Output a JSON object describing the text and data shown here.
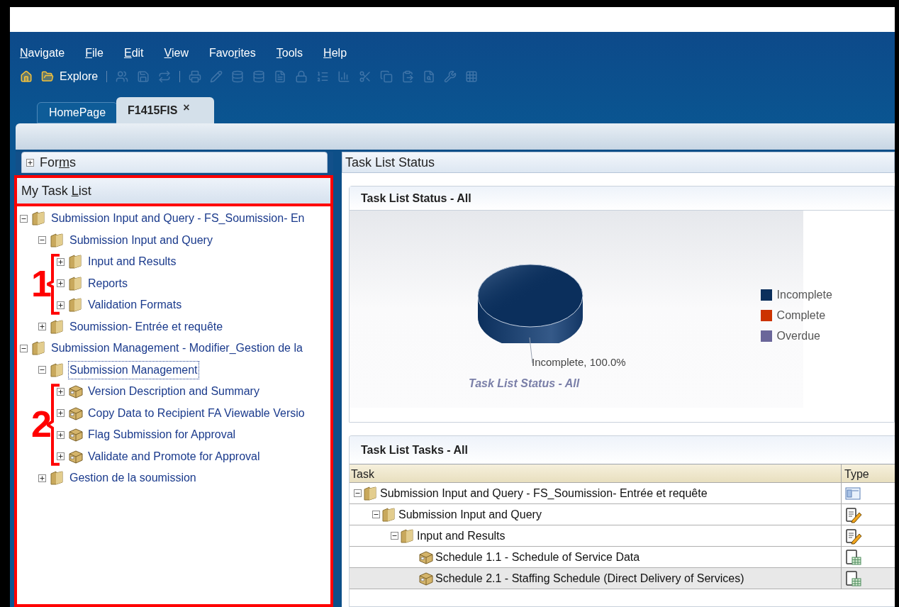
{
  "menu": [
    {
      "key": "N",
      "after": "avigate"
    },
    {
      "key": "F",
      "after": "ile"
    },
    {
      "key": "E",
      "after": "dit"
    },
    {
      "key": "V",
      "after": "iew"
    },
    {
      "before": "Favo",
      "key": "r",
      "after": "ites"
    },
    {
      "key": "T",
      "after": "ools"
    },
    {
      "key": "H",
      "after": "elp"
    }
  ],
  "toolbar": [
    {
      "kind": "icon",
      "disabled": false
    },
    {
      "kind": "icon",
      "disabled": false
    },
    {
      "kind": "button",
      "label": "Explore",
      "disabled": false
    },
    {
      "kind": "separator"
    },
    {
      "kind": "icon",
      "disabled": true
    },
    {
      "kind": "icon",
      "disabled": true
    },
    {
      "kind": "icon",
      "disabled": true
    },
    {
      "kind": "separator"
    },
    {
      "kind": "icon",
      "disabled": true
    },
    {
      "kind": "icon",
      "disabled": true
    },
    {
      "kind": "icon",
      "disabled": true
    },
    {
      "kind": "icon",
      "disabled": true
    },
    {
      "kind": "icon",
      "disabled": true
    },
    {
      "kind": "icon",
      "disabled": true
    },
    {
      "kind": "icon",
      "disabled": true
    },
    {
      "kind": "icon",
      "disabled": true
    },
    {
      "kind": "icon",
      "disabled": true
    },
    {
      "kind": "icon",
      "disabled": true
    },
    {
      "kind": "icon",
      "disabled": true
    },
    {
      "kind": "icon",
      "disabled": true
    },
    {
      "kind": "icon",
      "disabled": true
    },
    {
      "kind": "icon",
      "disabled": true
    }
  ],
  "tabs": [
    {
      "label": "HomePage",
      "selected": false
    },
    {
      "label": "F1415FIS",
      "selected": true,
      "close": "×"
    }
  ],
  "forms_panel": {
    "before": "For",
    "key": "m",
    "after": "s",
    "expanded": false
  },
  "task_list_panel": {
    "title": {
      "before": "My Task ",
      "key": "L",
      "after": "ist"
    },
    "tree": [
      {
        "label": "Submission Input and Query - FS_Soumission- En",
        "kind": "folder",
        "expanded": true,
        "selected": false,
        "children": [
          {
            "label": "Submission Input and Query",
            "kind": "folder",
            "expanded": true,
            "selected": false,
            "children_marker": "1",
            "children": [
              {
                "label": "Input and Results",
                "kind": "folder",
                "expanded": false,
                "selected": false
              },
              {
                "label": "Reports",
                "kind": "folder",
                "expanded": false,
                "selected": false
              },
              {
                "label": "Validation Formats",
                "kind": "folder",
                "expanded": false,
                "selected": false
              }
            ]
          },
          {
            "label": "Soumission- Entrée et requête",
            "kind": "folder",
            "expanded": false,
            "selected": false
          }
        ]
      },
      {
        "label": "Submission Management - Modifier_Gestion de la",
        "kind": "folder",
        "expanded": true,
        "selected": false,
        "children": [
          {
            "label": "Submission Management",
            "kind": "folder",
            "expanded": true,
            "selected": true,
            "children_marker": "2",
            "children": [
              {
                "label": "Version Description and Summary",
                "kind": "task",
                "expanded": false,
                "selected": false
              },
              {
                "label": "Copy Data to Recipient FA Viewable Versio",
                "kind": "task",
                "expanded": false,
                "selected": false
              },
              {
                "label": "Flag Submission for Approval",
                "kind": "task",
                "expanded": false,
                "selected": false
              },
              {
                "label": "Validate and Promote for Approval",
                "kind": "task",
                "expanded": false,
                "selected": false
              }
            ]
          },
          {
            "label": "Gestion de la soumission",
            "kind": "folder",
            "expanded": false,
            "selected": false
          }
        ]
      }
    ]
  },
  "status_panel": {
    "title": "Task List Status",
    "status_card": {
      "title": "Task List Status - All",
      "chart_data": {
        "type": "pie",
        "title": "Task List Status - All",
        "categories": [
          "Incomplete",
          "Complete",
          "Overdue"
        ],
        "colors": [
          "#0b2f5c",
          "#cc3300",
          "#6a669a"
        ],
        "values": [
          100,
          0,
          0
        ],
        "value_labels": [
          "Incomplete, 100.0%",
          null,
          null
        ]
      }
    },
    "tasks_card": {
      "title": "Task List Tasks - All",
      "columns": [
        "Task",
        "Type"
      ],
      "rows": [
        {
          "task": "Submission Input and Query - FS_Soumission- Entrée et requête",
          "kind": "folder",
          "type": {
            "kind": "form-group"
          },
          "expanded": true,
          "selected": false,
          "children": [
            {
              "task": "Submission Input and Query",
              "kind": "folder",
              "type": {
                "kind": "edit"
              },
              "expanded": true,
              "selected": false,
              "children": [
                {
                  "task": "Input and Results",
                  "kind": "folder",
                  "type": {
                    "kind": "edit"
                  },
                  "expanded": true,
                  "selected": false,
                  "children": [
                    {
                      "task": "Schedule 1.1 - Schedule of Service Data",
                      "kind": "task",
                      "type": {
                        "kind": "schedule"
                      },
                      "selected": false
                    },
                    {
                      "task": "Schedule 2.1 - Staffing Schedule (Direct Delivery of Services)",
                      "kind": "task",
                      "type": {
                        "kind": "schedule"
                      },
                      "selected": true
                    }
                  ]
                }
              ]
            }
          ]
        }
      ]
    }
  }
}
